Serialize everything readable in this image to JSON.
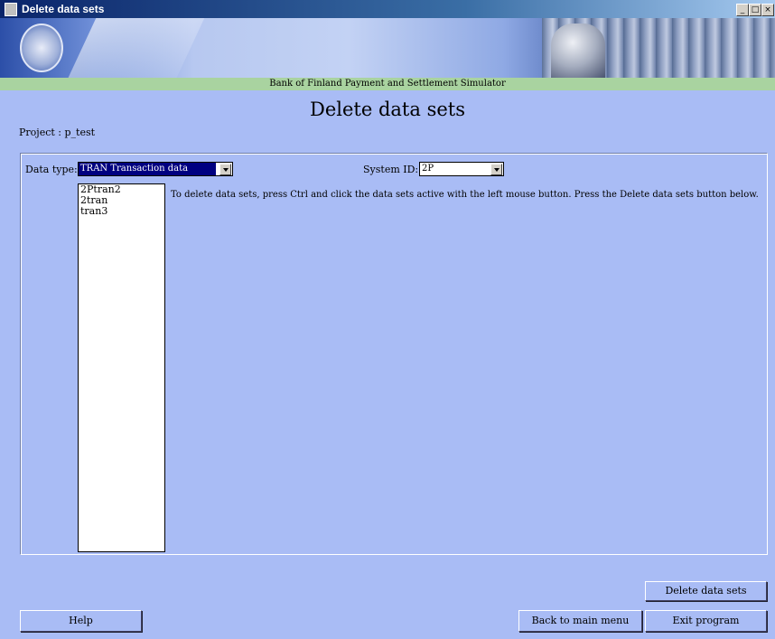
{
  "window": {
    "title": "Delete data sets",
    "minimize": "_",
    "maximize": "□",
    "close": "×"
  },
  "banner": {
    "subtitle": "Bank of Finland Payment and Settlement Simulator"
  },
  "page": {
    "heading": "Delete data sets",
    "project_label": "Project : p_test"
  },
  "form": {
    "data_type_label": "Data type:",
    "data_type_value": "TRAN Transaction data",
    "system_id_label": "System ID:",
    "system_id_value": "2P",
    "datasets": [
      "2Ptran2",
      "2tran",
      "tran3"
    ],
    "instructions": "To delete data sets, press Ctrl and click the data sets active with the left mouse button. Press the Delete data sets button below."
  },
  "buttons": {
    "delete": "Delete data sets",
    "help": "Help",
    "back": "Back to main menu",
    "exit": "Exit program"
  },
  "colors": {
    "background": "#a9bcf5",
    "banner_strip": "#a9d3a0",
    "titlebar": "#0a246a"
  }
}
